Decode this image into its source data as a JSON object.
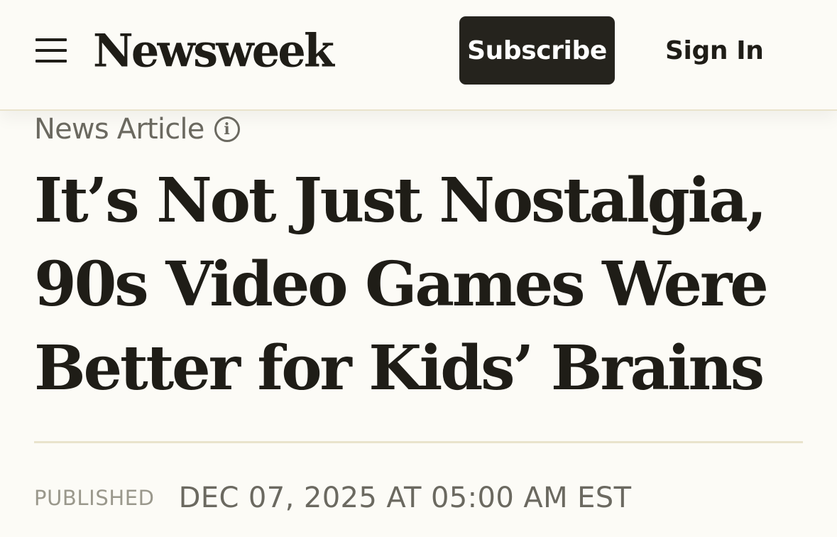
{
  "header": {
    "logo_text": "Newsweek",
    "subscribe_label": "Subscribe",
    "signin_label": "Sign In",
    "menu_icon": "hamburger-menu-icon"
  },
  "article": {
    "type_label": "News Article",
    "info_icon_glyph": "i",
    "headline": "It’s Not Just Nostalgia, 90s Video Games Were Better for Kids’ Brains",
    "published_label": "PUBLISHED",
    "published_date": "DEC 07, 2025 AT 05:00 AM EST"
  },
  "colors": {
    "background": "#fcfbf6",
    "text_primary": "#1f1d17",
    "text_secondary": "#6b6960",
    "text_muted": "#9a988c",
    "subscribe_bg": "#25231d",
    "divider": "#e9e3cc"
  }
}
